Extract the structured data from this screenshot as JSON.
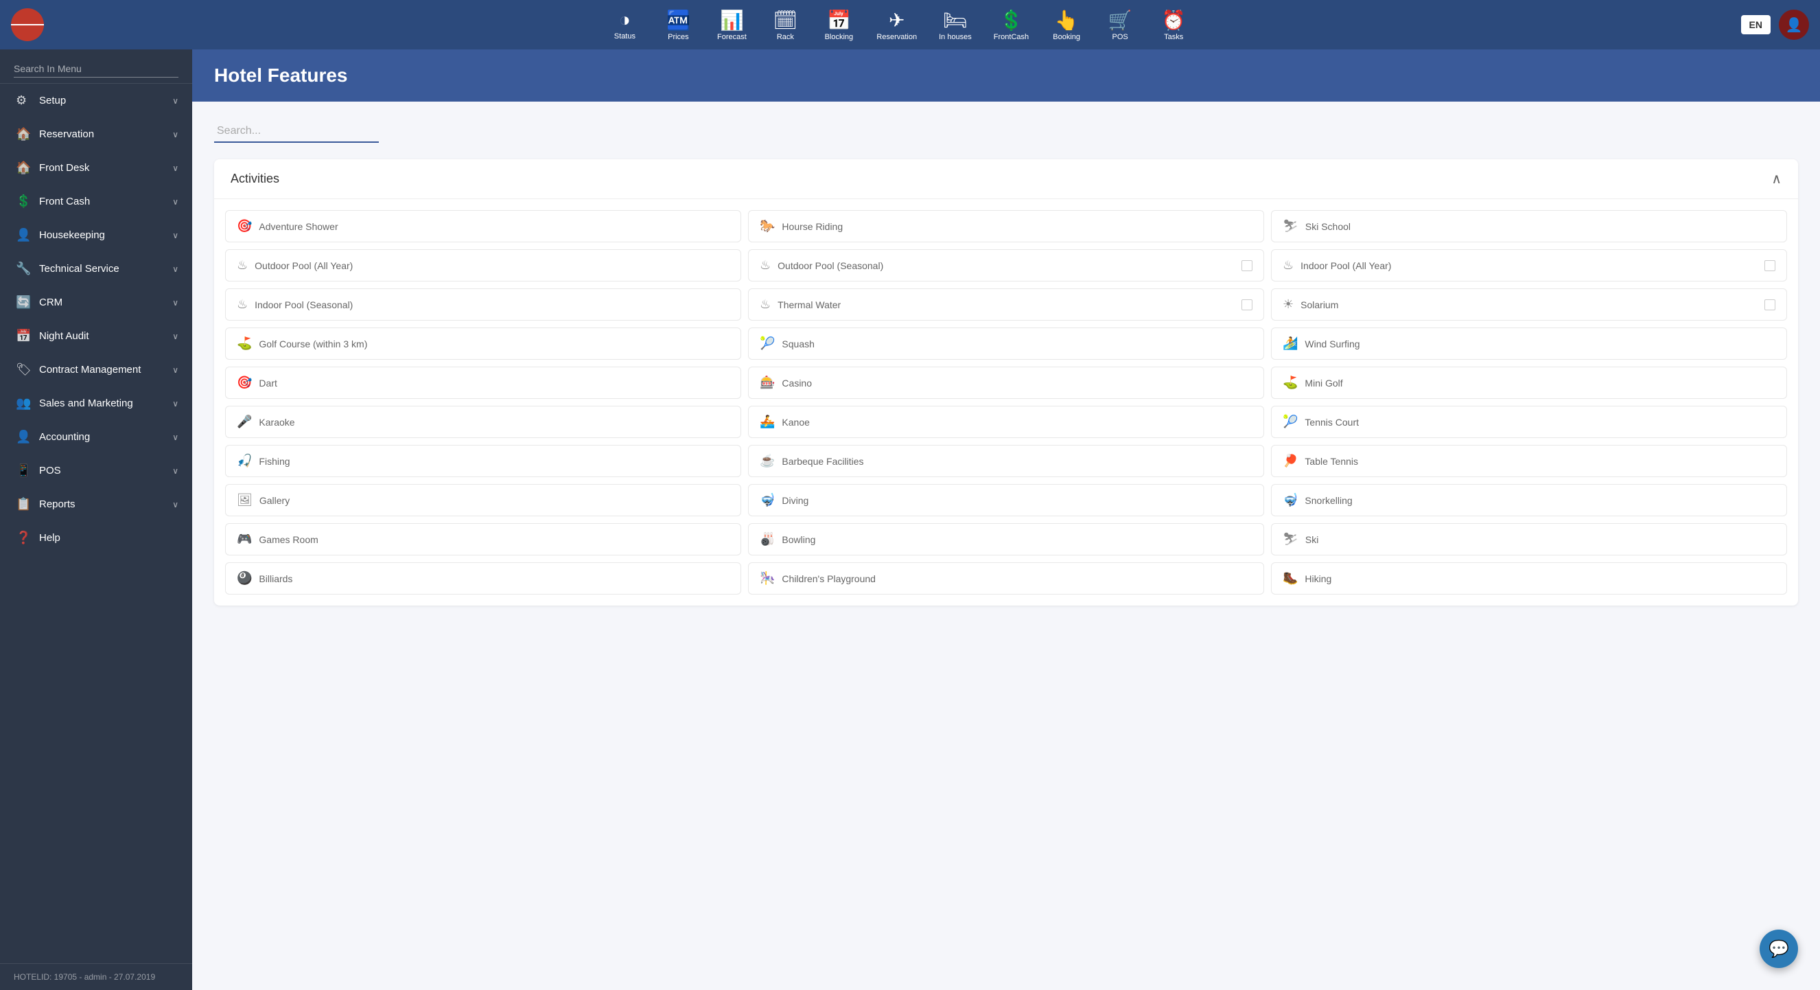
{
  "topNav": {
    "items": [
      {
        "id": "status",
        "label": "Status",
        "icon": "◑"
      },
      {
        "id": "prices",
        "label": "Prices",
        "icon": "🏧"
      },
      {
        "id": "forecast",
        "label": "Forecast",
        "icon": "📊"
      },
      {
        "id": "rack",
        "label": "Rack",
        "icon": "🗓"
      },
      {
        "id": "blocking",
        "label": "Blocking",
        "icon": "📅"
      },
      {
        "id": "reservation",
        "label": "Reservation",
        "icon": "✈"
      },
      {
        "id": "inhouses",
        "label": "In houses",
        "icon": "🛏"
      },
      {
        "id": "frontcash",
        "label": "FrontCash",
        "icon": "💲"
      },
      {
        "id": "booking",
        "label": "Booking",
        "icon": "👆"
      },
      {
        "id": "pos",
        "label": "POS",
        "icon": "🛒"
      },
      {
        "id": "tasks",
        "label": "Tasks",
        "icon": "⏰"
      }
    ],
    "langLabel": "EN"
  },
  "sidebar": {
    "searchPlaceholder": "Search In Menu",
    "items": [
      {
        "id": "setup",
        "label": "Setup",
        "icon": "⚙",
        "hasArrow": true
      },
      {
        "id": "reservation",
        "label": "Reservation",
        "icon": "🏠",
        "hasArrow": true
      },
      {
        "id": "frontdesk",
        "label": "Front Desk",
        "icon": "🏠",
        "hasArrow": true
      },
      {
        "id": "frontcash",
        "label": "Front Cash",
        "icon": "💲",
        "hasArrow": true
      },
      {
        "id": "housekeeping",
        "label": "Housekeeping",
        "icon": "👤",
        "hasArrow": true
      },
      {
        "id": "technicalservice",
        "label": "Technical Service",
        "icon": "🔧",
        "hasArrow": true
      },
      {
        "id": "crm",
        "label": "CRM",
        "icon": "🔄",
        "hasArrow": true
      },
      {
        "id": "nightaudit",
        "label": "Night Audit",
        "icon": "📅",
        "hasArrow": true
      },
      {
        "id": "contractmanagement",
        "label": "Contract Management",
        "icon": "🏷",
        "hasArrow": true
      },
      {
        "id": "salesmarketing",
        "label": "Sales and Marketing",
        "icon": "👥",
        "hasArrow": true
      },
      {
        "id": "accounting",
        "label": "Accounting",
        "icon": "👤",
        "hasArrow": true
      },
      {
        "id": "pos",
        "label": "POS",
        "icon": "📱",
        "hasArrow": true
      },
      {
        "id": "reports",
        "label": "Reports",
        "icon": "📋",
        "hasArrow": true
      },
      {
        "id": "help",
        "label": "Help",
        "icon": "❓",
        "hasArrow": false
      }
    ],
    "footer": "HOTELID: 19705 - admin - 27.07.2019"
  },
  "page": {
    "title": "Hotel Features",
    "searchPlaceholder": "Search..."
  },
  "activities": {
    "sectionTitle": "Activities",
    "items": [
      {
        "id": "adventure-shower",
        "label": "Adventure Shower",
        "icon": "🎯",
        "checked": false,
        "showCheckbox": false
      },
      {
        "id": "hourse-riding",
        "label": "Hourse Riding",
        "icon": "🐎",
        "checked": false,
        "showCheckbox": false
      },
      {
        "id": "ski-school",
        "label": "Ski School",
        "icon": "⛷",
        "checked": false,
        "showCheckbox": false
      },
      {
        "id": "outdoor-pool-year",
        "label": "Outdoor Pool (All Year)",
        "icon": "♨",
        "checked": false,
        "showCheckbox": false
      },
      {
        "id": "outdoor-pool-seasonal",
        "label": "Outdoor Pool (Seasonal)",
        "icon": "♨",
        "checked": false,
        "showCheckbox": true
      },
      {
        "id": "indoor-pool-year",
        "label": "Indoor Pool (All Year)",
        "icon": "♨",
        "checked": false,
        "showCheckbox": true
      },
      {
        "id": "indoor-pool-seasonal",
        "label": "Indoor Pool (Seasonal)",
        "icon": "♨",
        "checked": false,
        "showCheckbox": false
      },
      {
        "id": "thermal-water",
        "label": "Thermal Water",
        "icon": "♨",
        "checked": false,
        "showCheckbox": true
      },
      {
        "id": "solarium",
        "label": "Solarium",
        "icon": "☀",
        "checked": false,
        "showCheckbox": true
      },
      {
        "id": "golf-course",
        "label": "Golf Course (within 3 km)",
        "icon": "⛳",
        "checked": false,
        "showCheckbox": false
      },
      {
        "id": "squash",
        "label": "Squash",
        "icon": "🎾",
        "checked": false,
        "showCheckbox": false
      },
      {
        "id": "wind-surfing",
        "label": "Wind Surfing",
        "icon": "🏄",
        "checked": false,
        "showCheckbox": false
      },
      {
        "id": "dart",
        "label": "Dart",
        "icon": "🎯",
        "checked": false,
        "showCheckbox": false
      },
      {
        "id": "casino",
        "label": "Casino",
        "icon": "🎰",
        "checked": false,
        "showCheckbox": false
      },
      {
        "id": "mini-golf",
        "label": "Mini Golf",
        "icon": "⛳",
        "checked": false,
        "showCheckbox": false
      },
      {
        "id": "karaoke",
        "label": "Karaoke",
        "icon": "🎤",
        "checked": false,
        "showCheckbox": false
      },
      {
        "id": "kanoe",
        "label": "Kanoe",
        "icon": "🚣",
        "checked": false,
        "showCheckbox": false
      },
      {
        "id": "tennis-court",
        "label": "Tennis Court",
        "icon": "🎾",
        "checked": false,
        "showCheckbox": false
      },
      {
        "id": "fishing",
        "label": "Fishing",
        "icon": "🎣",
        "checked": false,
        "showCheckbox": false
      },
      {
        "id": "barbeque-facilities",
        "label": "Barbeque Facilities",
        "icon": "☕",
        "checked": false,
        "showCheckbox": false
      },
      {
        "id": "table-tennis",
        "label": "Table Tennis",
        "icon": "🏓",
        "checked": false,
        "showCheckbox": false
      },
      {
        "id": "gallery",
        "label": "Gallery",
        "icon": "🖼",
        "checked": false,
        "showCheckbox": false
      },
      {
        "id": "diving",
        "label": "Diving",
        "icon": "🤿",
        "checked": false,
        "showCheckbox": false
      },
      {
        "id": "snorkelling",
        "label": "Snorkelling",
        "icon": "🤿",
        "checked": false,
        "showCheckbox": false
      },
      {
        "id": "games-room",
        "label": "Games Room",
        "icon": "🎮",
        "checked": false,
        "showCheckbox": false
      },
      {
        "id": "bowling",
        "label": "Bowling",
        "icon": "🎳",
        "checked": false,
        "showCheckbox": false
      },
      {
        "id": "ski",
        "label": "Ski",
        "icon": "⛷",
        "checked": false,
        "showCheckbox": false
      },
      {
        "id": "billiards",
        "label": "Billiards",
        "icon": "🎱",
        "checked": false,
        "showCheckbox": false
      },
      {
        "id": "childrens-playground",
        "label": "Children's Playground",
        "icon": "🎠",
        "checked": false,
        "showCheckbox": false
      },
      {
        "id": "hiking",
        "label": "Hiking",
        "icon": "🥾",
        "checked": false,
        "showCheckbox": false
      }
    ]
  }
}
